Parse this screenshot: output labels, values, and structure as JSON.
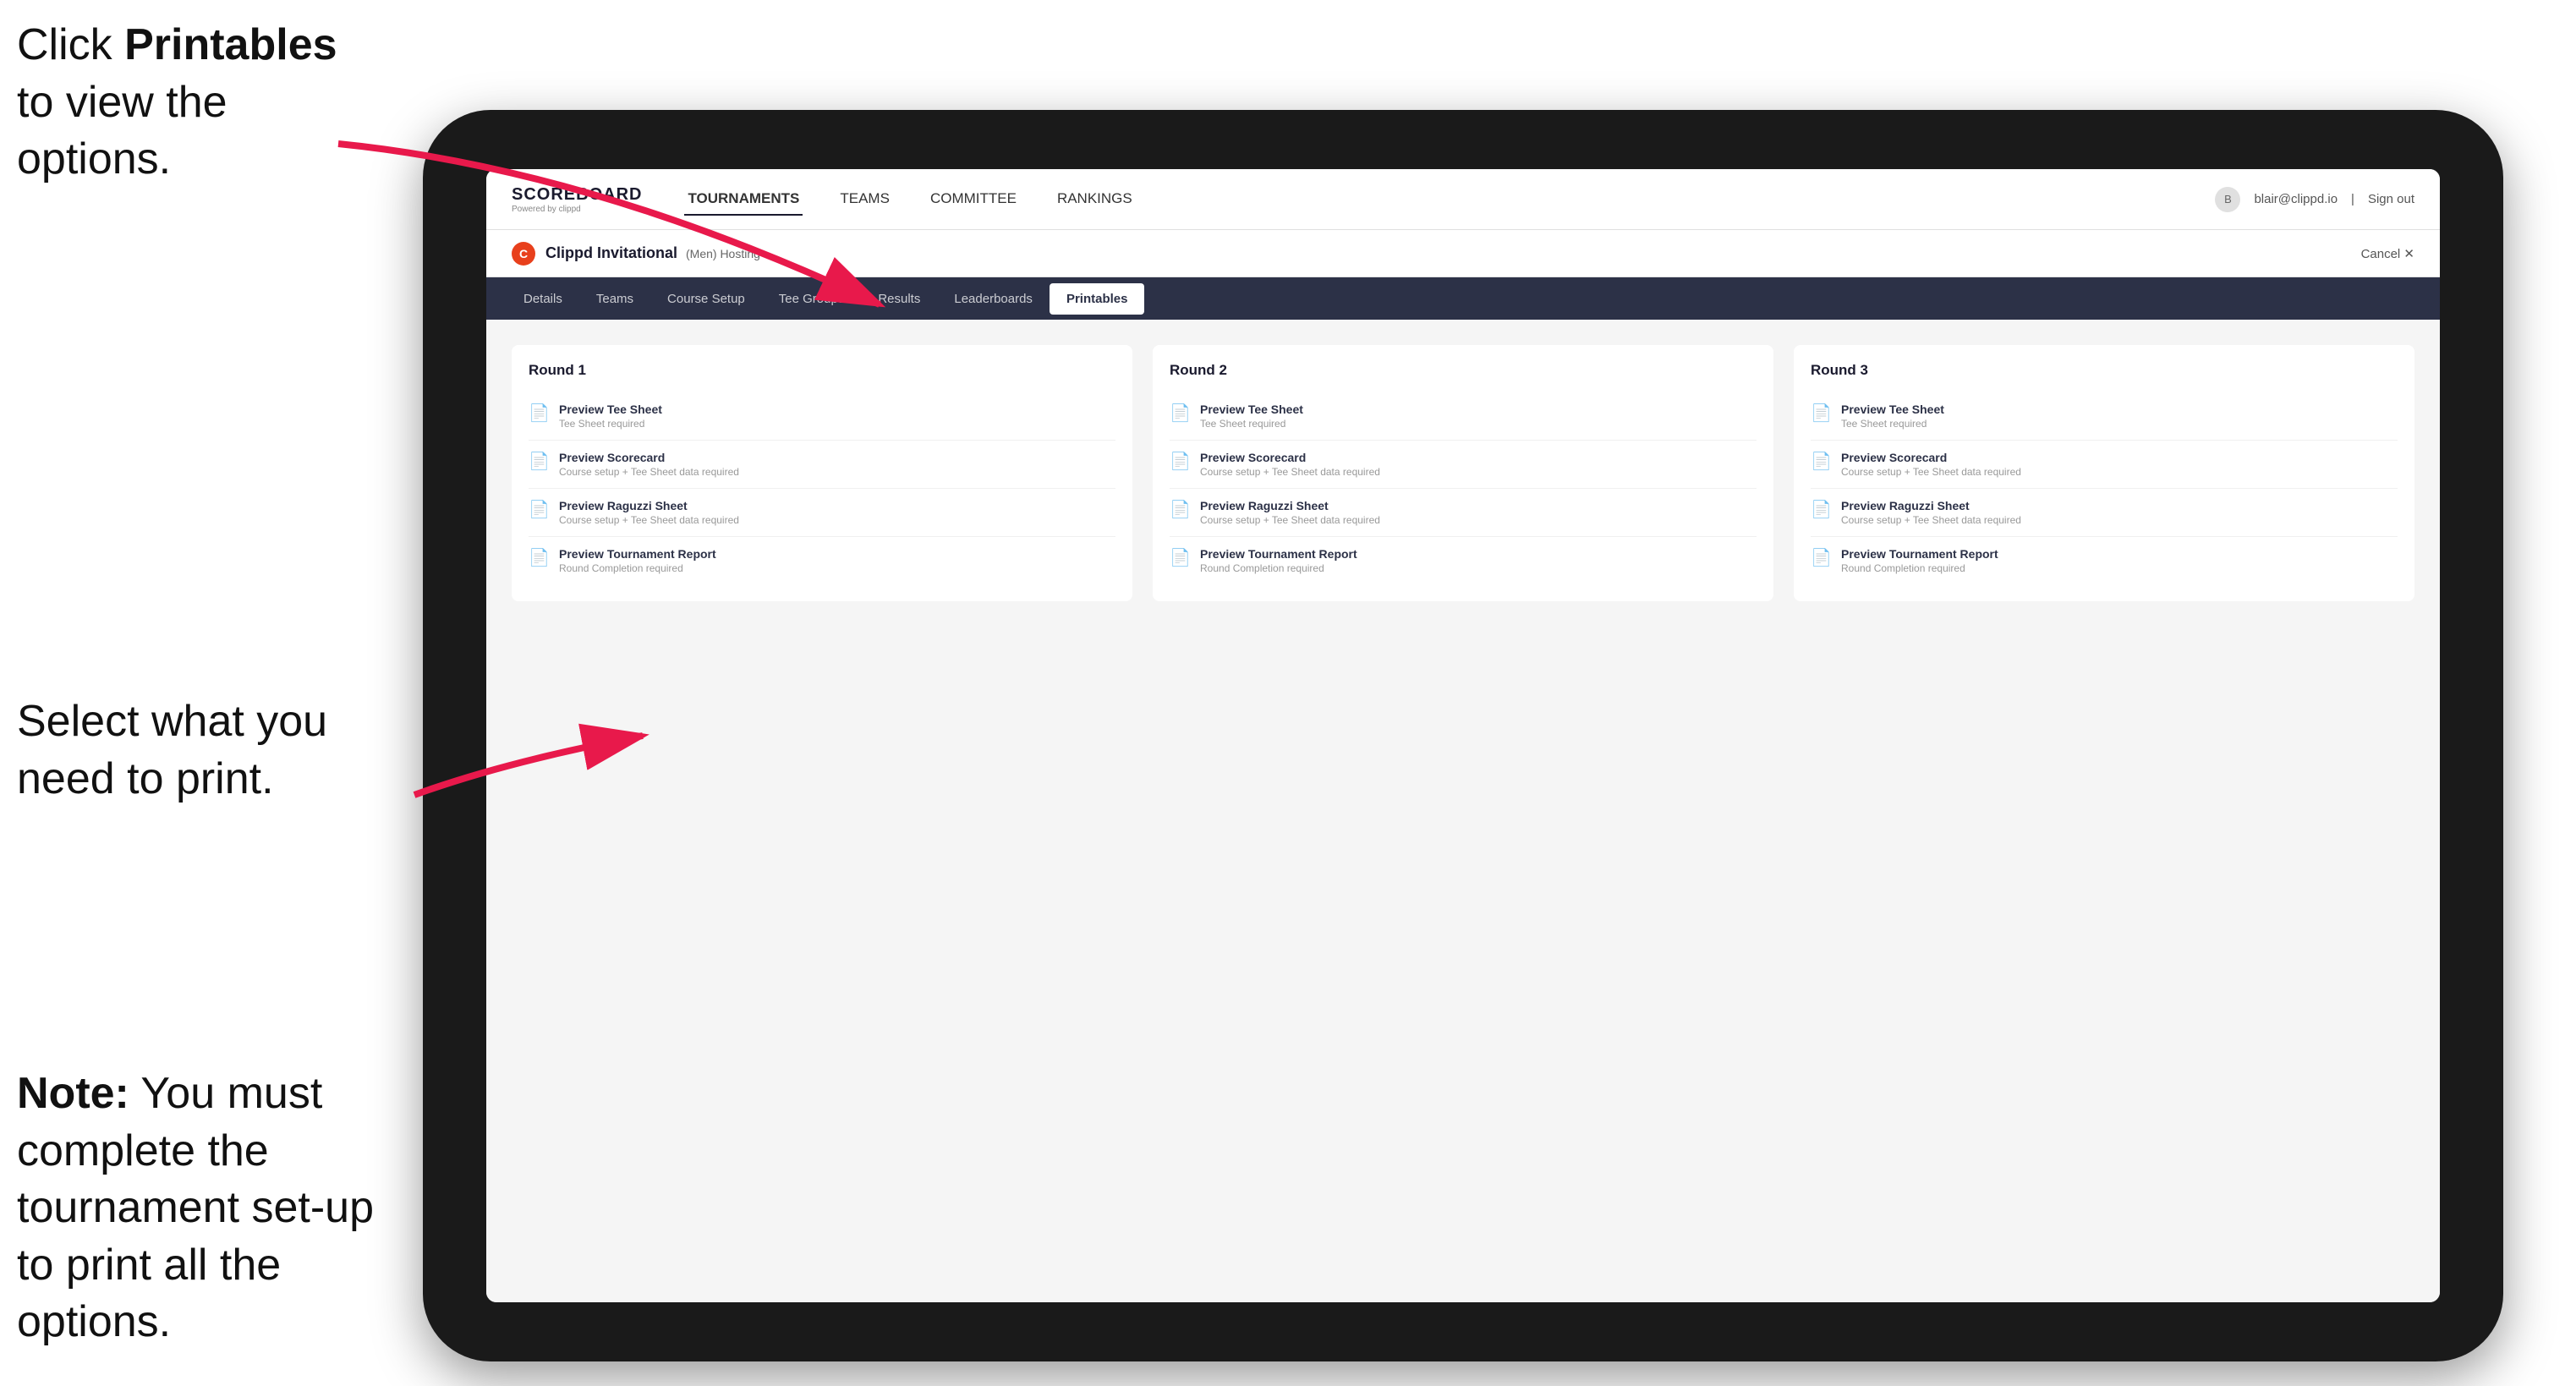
{
  "annotations": {
    "top": {
      "prefix": "Click ",
      "bold": "Printables",
      "suffix": " to view the options."
    },
    "middle": {
      "text": "Select what you need to print."
    },
    "bottom": {
      "bold": "Note:",
      "text": " You must complete the tournament set-up to print all the options."
    }
  },
  "nav": {
    "logo_title": "SCOREBOARD",
    "logo_sub": "Powered by clippd",
    "links": [
      "TOURNAMENTS",
      "TEAMS",
      "COMMITTEE",
      "RANKINGS"
    ],
    "active_link": "TOURNAMENTS",
    "user_email": "blair@clippd.io",
    "sign_out": "Sign out"
  },
  "sub_header": {
    "icon": "C",
    "tournament_name": "Clippd Invitational",
    "tournament_details": "(Men)  Hosting",
    "cancel_label": "Cancel ✕"
  },
  "tabs": {
    "items": [
      "Details",
      "Teams",
      "Course Setup",
      "Tee Groups",
      "Results",
      "Leaderboards",
      "Printables"
    ],
    "active": "Printables"
  },
  "rounds": [
    {
      "title": "Round 1",
      "items": [
        {
          "title": "Preview Tee Sheet",
          "sub": "Tee Sheet required"
        },
        {
          "title": "Preview Scorecard",
          "sub": "Course setup + Tee Sheet data required"
        },
        {
          "title": "Preview Raguzzi Sheet",
          "sub": "Course setup + Tee Sheet data required"
        },
        {
          "title": "Preview Tournament Report",
          "sub": "Round Completion required"
        }
      ]
    },
    {
      "title": "Round 2",
      "items": [
        {
          "title": "Preview Tee Sheet",
          "sub": "Tee Sheet required"
        },
        {
          "title": "Preview Scorecard",
          "sub": "Course setup + Tee Sheet data required"
        },
        {
          "title": "Preview Raguzzi Sheet",
          "sub": "Course setup + Tee Sheet data required"
        },
        {
          "title": "Preview Tournament Report",
          "sub": "Round Completion required"
        }
      ]
    },
    {
      "title": "Round 3",
      "items": [
        {
          "title": "Preview Tee Sheet",
          "sub": "Tee Sheet required"
        },
        {
          "title": "Preview Scorecard",
          "sub": "Course setup + Tee Sheet data required"
        },
        {
          "title": "Preview Raguzzi Sheet",
          "sub": "Course setup + Tee Sheet data required"
        },
        {
          "title": "Preview Tournament Report",
          "sub": "Round Completion required"
        }
      ]
    }
  ]
}
